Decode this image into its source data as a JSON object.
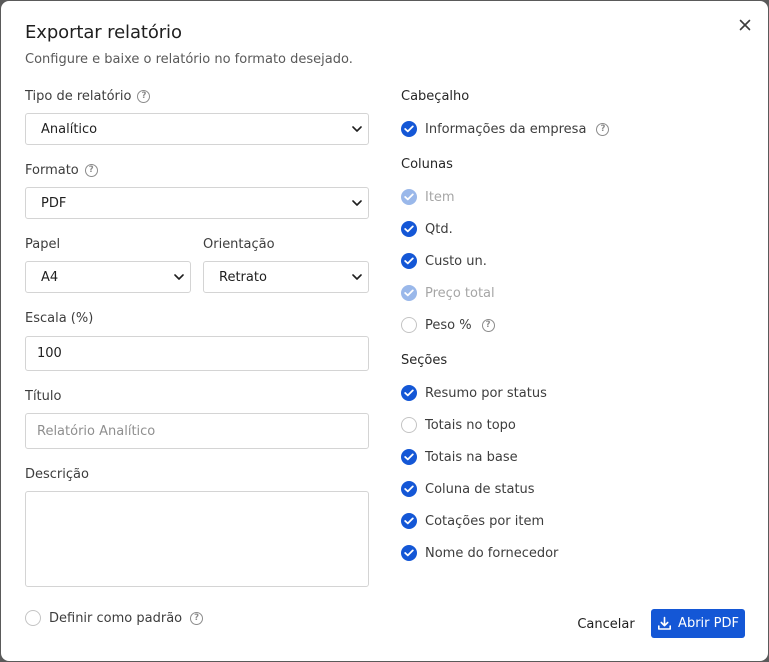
{
  "dialog": {
    "title": "Exportar relatório",
    "subtitle": "Configure e baixe o relatório no formato desejado."
  },
  "form": {
    "report_type": {
      "label": "Tipo de relatório",
      "value": "Analítico"
    },
    "format": {
      "label": "Formato",
      "value": "PDF"
    },
    "paper": {
      "label": "Papel",
      "value": "A4"
    },
    "orientation": {
      "label": "Orientação",
      "value": "Retrato"
    },
    "scale": {
      "label": "Escala (%)",
      "value": "100"
    },
    "title_field": {
      "label": "Título",
      "placeholder": "Relatório Analítico"
    },
    "description": {
      "label": "Descrição",
      "value": ""
    },
    "set_default": {
      "label": "Definir como padrão",
      "checked": false
    }
  },
  "header_section": {
    "heading": "Cabeçalho",
    "items": [
      {
        "label": "Informações da empresa",
        "state": "checked"
      }
    ]
  },
  "columns_section": {
    "heading": "Colunas",
    "items": [
      {
        "label": "Item",
        "state": "disabled-checked"
      },
      {
        "label": "Qtd.",
        "state": "checked"
      },
      {
        "label": "Custo un.",
        "state": "checked"
      },
      {
        "label": "Preço total",
        "state": "disabled-checked"
      },
      {
        "label": "Peso %",
        "state": "unchecked"
      }
    ]
  },
  "sections_section": {
    "heading": "Seções",
    "items": [
      {
        "label": "Resumo por status",
        "state": "checked"
      },
      {
        "label": "Totais no topo",
        "state": "unchecked"
      },
      {
        "label": "Totais na base",
        "state": "checked"
      },
      {
        "label": "Coluna de status",
        "state": "checked"
      },
      {
        "label": "Cotações por item",
        "state": "checked"
      },
      {
        "label": "Nome do fornecedor",
        "state": "checked"
      }
    ]
  },
  "footer": {
    "cancel_label": "Cancelar",
    "primary_label": "Abrir PDF"
  },
  "colors": {
    "accent": "#1457d6",
    "accent_disabled": "#9ab8ea",
    "overlay": "#5a5a5a"
  }
}
